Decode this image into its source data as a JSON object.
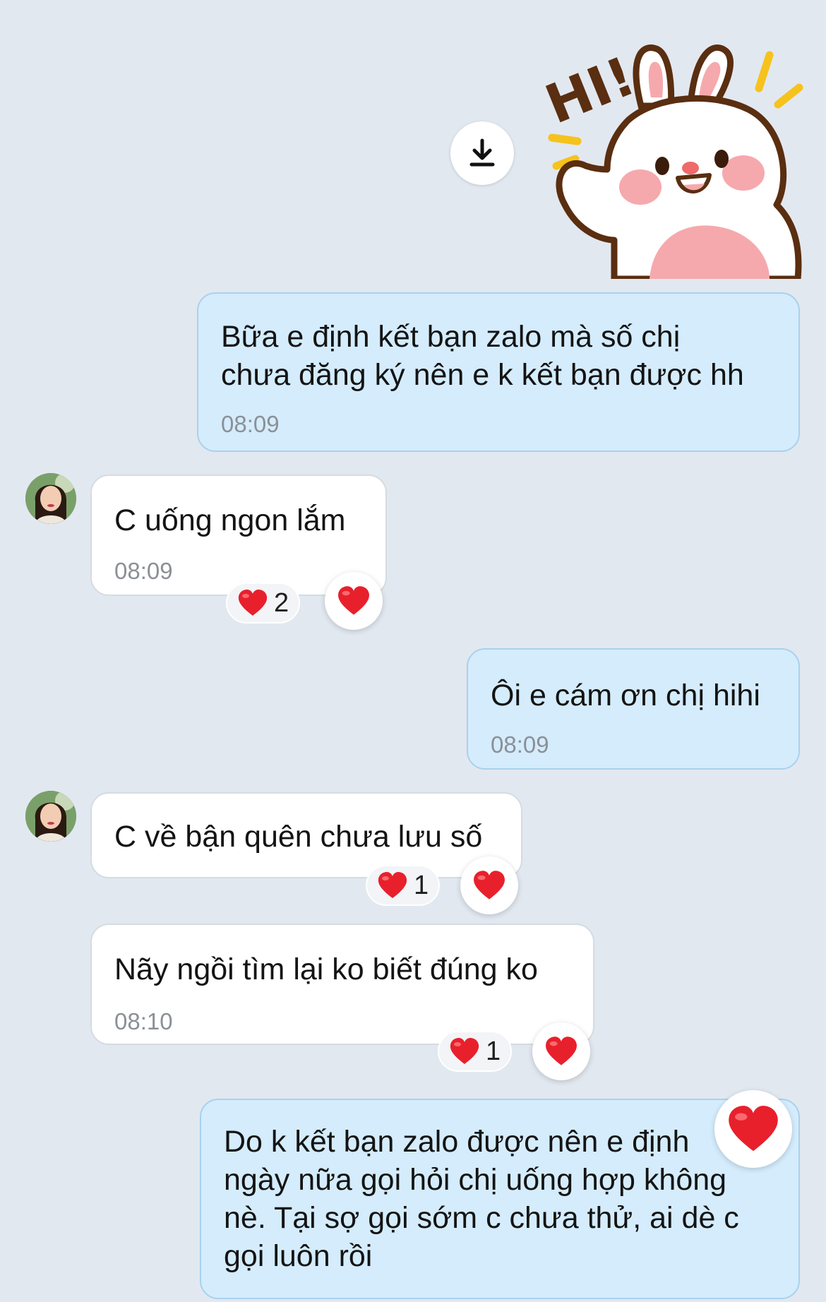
{
  "sticker": {
    "text": "HI!"
  },
  "download_button": {
    "icon": "download-icon"
  },
  "messages": [
    {
      "text": "Bữa e định kết bạn zalo mà số chị\nchưa đăng ký nên e k kết bạn được hh",
      "time": "08:09"
    },
    {
      "text": "C uống ngon lắm",
      "time": "08:09",
      "reaction_count": "2"
    },
    {
      "text": "Ôi e cám ơn chị hihi",
      "time": "08:09"
    },
    {
      "text": "C về bận quên chưa lưu số",
      "reaction_count": "1"
    },
    {
      "text": "Nãy ngồi tìm lại ko biết đúng ko",
      "time": "08:10",
      "reaction_count": "1"
    },
    {
      "text": "Do k kết bạn zalo được nên e định\nngày nữa gọi hỏi chị uống hợp không\nnè. Tại sợ gọi sớm c chưa thử, ai dè c\ngọi luôn rồi"
    }
  ],
  "colors": {
    "my_bubble": "#d4ecfc",
    "their_bubble": "#ffffff",
    "background": "#e2e8f0",
    "heart": "#e8202c"
  }
}
